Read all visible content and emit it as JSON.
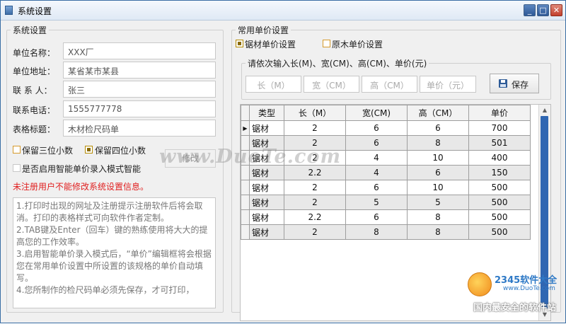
{
  "window": {
    "title": "系统设置",
    "controls": {
      "minimize": "_",
      "maximize": "□",
      "close": "✕"
    }
  },
  "settings": {
    "group_title": "系统设置",
    "fields": [
      {
        "label": "单位名称：",
        "value": "XXX厂"
      },
      {
        "label": "单位地址：",
        "value": "某省某市某县"
      },
      {
        "label": "联 系 人：",
        "value": "张三"
      },
      {
        "label": "联系电话：",
        "value": "1555777778"
      },
      {
        "label": "表格标题：",
        "value": "木材检尺码单"
      }
    ],
    "keep3_label": "保留三位小数",
    "keep3_checked": false,
    "keep4_label": "保留四位小数",
    "keep4_checked": true,
    "smart_mode_label": "是否启用智能单价录入模式智能",
    "smart_mode_checked": false,
    "modify_button": "修改",
    "warning": "未注册用户不能修改系统设置信息。",
    "notes": [
      "1.打印时出现的网址及注册提示注册软件后将会取消。打印的表格样式可向软件作者定制。",
      "2.TAB键及Enter（回车）键的熟练使用将大大的提高您的工作效率。",
      "3.启用智能单价录入模式后，“单价”编辑框将会根据您在常用单价设置中所设置的该规格的单价自动填写。",
      "4.您所制作的检尺码单必须先保存，才可打印，"
    ]
  },
  "price": {
    "group_title": "常用单价设置",
    "sawn_label": "锯材单价设置",
    "sawn_checked": true,
    "log_label": "原木单价设置",
    "log_checked": false,
    "input_group_title": "请依次输入长(M)、宽(CM)、高(CM)、单价(元)",
    "placeholders": {
      "length": "长（M）",
      "width": "宽（CM）",
      "height": "高（CM）",
      "price": "单价（元）"
    },
    "save_button": "保存",
    "table": {
      "headers": [
        "类型",
        "长（M）",
        "宽(CM)",
        "高（CM）",
        "单价"
      ],
      "rows": [
        [
          "锯材",
          "2",
          "6",
          "6",
          "700"
        ],
        [
          "锯材",
          "2",
          "6",
          "8",
          "501"
        ],
        [
          "锯材",
          "2",
          "4",
          "10",
          "400"
        ],
        [
          "锯材",
          "2.2",
          "4",
          "6",
          "150"
        ],
        [
          "锯材",
          "2",
          "6",
          "10",
          "500"
        ],
        [
          "锯材",
          "2",
          "5",
          "5",
          "500"
        ],
        [
          "锯材",
          "2.2",
          "6",
          "8",
          "500"
        ],
        [
          "锯材",
          "2",
          "8",
          "8",
          "500"
        ]
      ],
      "current_row_marker": "▶"
    }
  },
  "overlays": {
    "watermark": "www.DuoTe.com",
    "logo_text": "2345软件大全",
    "logo_url": "www.DuoTe.com",
    "slogan": "国内最安全的软件站"
  }
}
